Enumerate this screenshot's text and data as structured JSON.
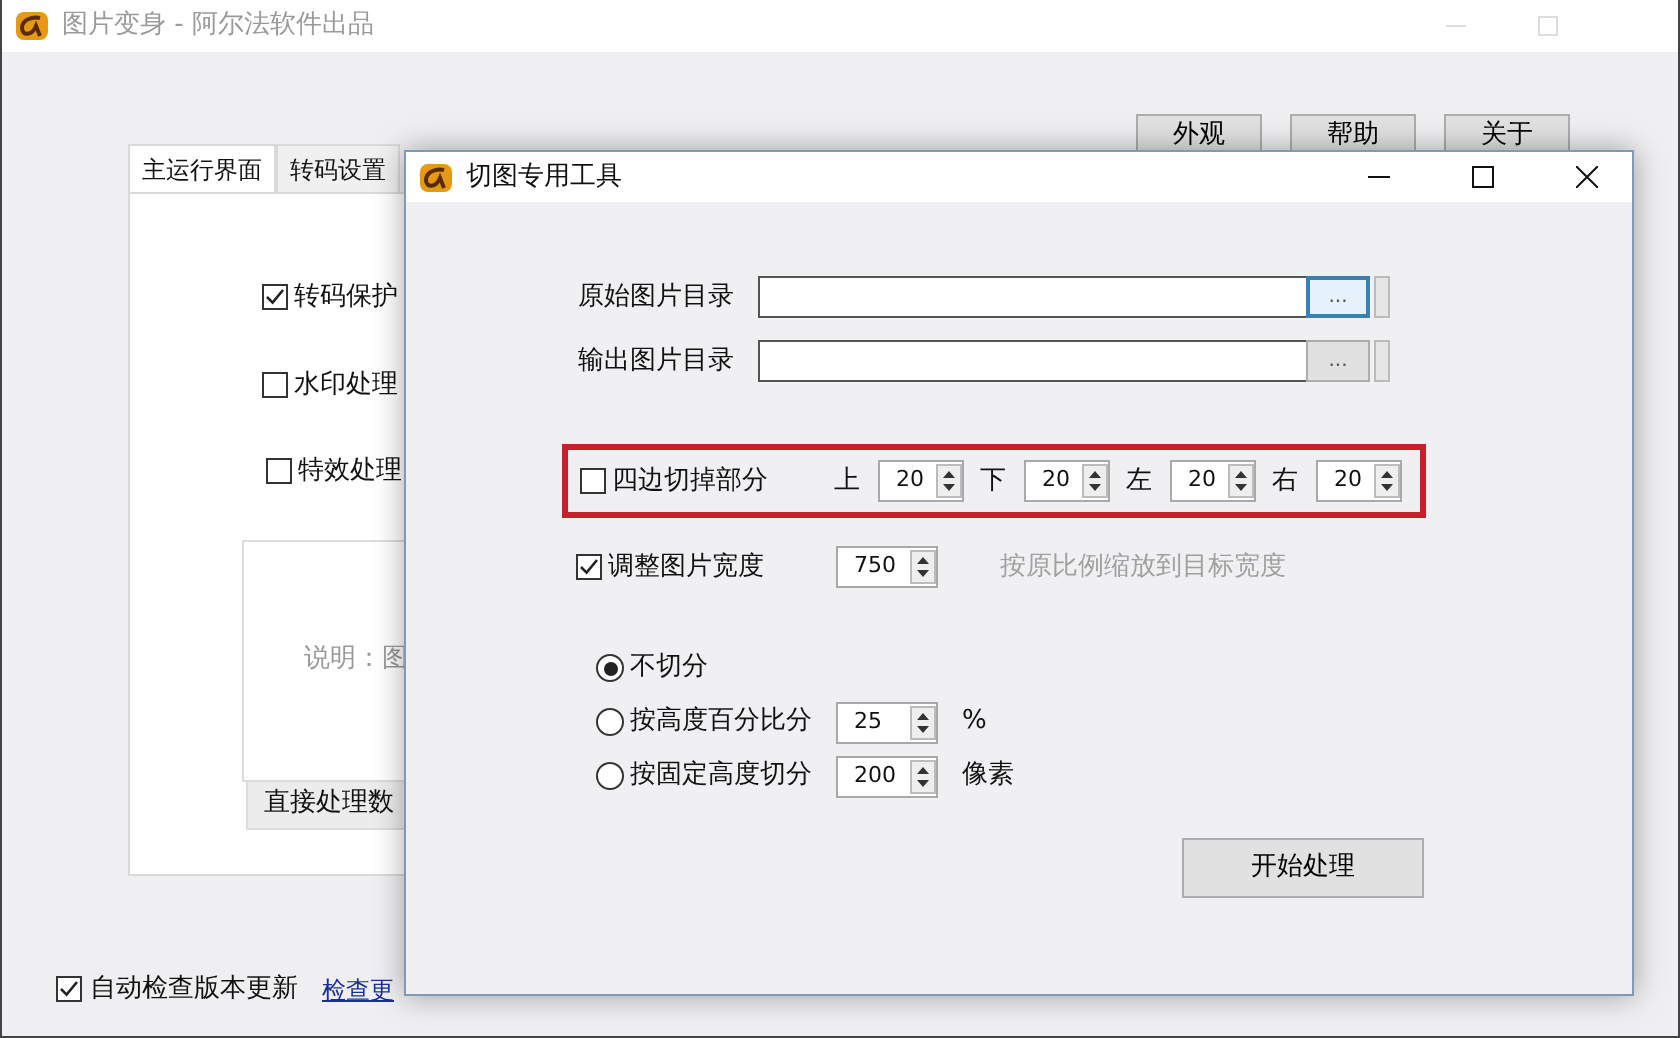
{
  "main_window": {
    "title": "图片变身 - 阿尔法软件出品",
    "header_buttons": [
      "外观",
      "帮助",
      "关于"
    ],
    "tabs": [
      {
        "label": "主运行界面",
        "selected": true
      },
      {
        "label": "转码设置",
        "selected": false
      }
    ],
    "options": [
      {
        "label": "转码保护",
        "checked": true
      },
      {
        "label": "水印处理",
        "checked": false
      },
      {
        "label": "特效处理",
        "checked": false
      }
    ],
    "description": "说明：图",
    "bottom_tab": "直接处理数",
    "auto_update": {
      "label": "自动检查版本更新",
      "checked": true
    },
    "check_update_link": "检查更"
  },
  "dialog": {
    "title": "切图专用工具",
    "dir_rows": [
      {
        "label": "原始图片目录",
        "browse": "...",
        "focused": true
      },
      {
        "label": "输出图片目录",
        "browse": "...",
        "focused": false
      }
    ],
    "trim": {
      "label": "四边切掉部分",
      "checked": false,
      "sides": [
        {
          "label": "上",
          "value": "20"
        },
        {
          "label": "下",
          "value": "20"
        },
        {
          "label": "左",
          "value": "20"
        },
        {
          "label": "右",
          "value": "20"
        }
      ]
    },
    "resize": {
      "label": "调整图片宽度",
      "checked": true,
      "value": "750",
      "hint": "按原比例缩放到目标宽度"
    },
    "split_modes": [
      {
        "label": "不切分",
        "selected": true
      },
      {
        "label": "按高度百分比分",
        "selected": false,
        "value": "25",
        "unit": "%"
      },
      {
        "label": "按固定高度切分",
        "selected": false,
        "value": "200",
        "unit": "像素"
      }
    ],
    "start_button": "开始处理"
  }
}
